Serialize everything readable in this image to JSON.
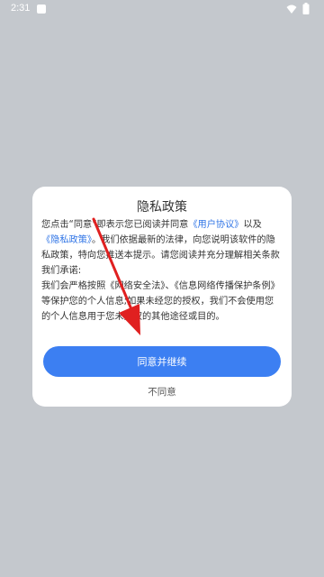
{
  "status_bar": {
    "time": "2:31",
    "icons": [
      "notification-icon",
      "wifi-icon",
      "battery-icon"
    ]
  },
  "dialog": {
    "title": "隐私政策",
    "body": {
      "p1_a": "您点击“同意”即表示您已阅读并同意",
      "link_user_agreement": "《用户协议》",
      "p1_b": "以及",
      "link_privacy_policy": "《隐私政策》",
      "p1_c": "。我们依据最新的法律，向您说明该软件的隐私政策，特向您推送本提示。请您阅读并充分理解相关条款我们承诺:",
      "p2": "我们会严格按照《网络安全法》、《信息网络传播保护条例》等保护您的个人信息;如果未经您的授权，我们不会使用您的个人信息用于您未授权的其他途径或目的。"
    },
    "agree_button": "同意并继续",
    "disagree_button": "不同意"
  },
  "colors": {
    "backdrop": "#c4c8cd",
    "accent": "#3c7ff2",
    "link": "#2f74e6",
    "annotation_arrow": "#e02020"
  }
}
